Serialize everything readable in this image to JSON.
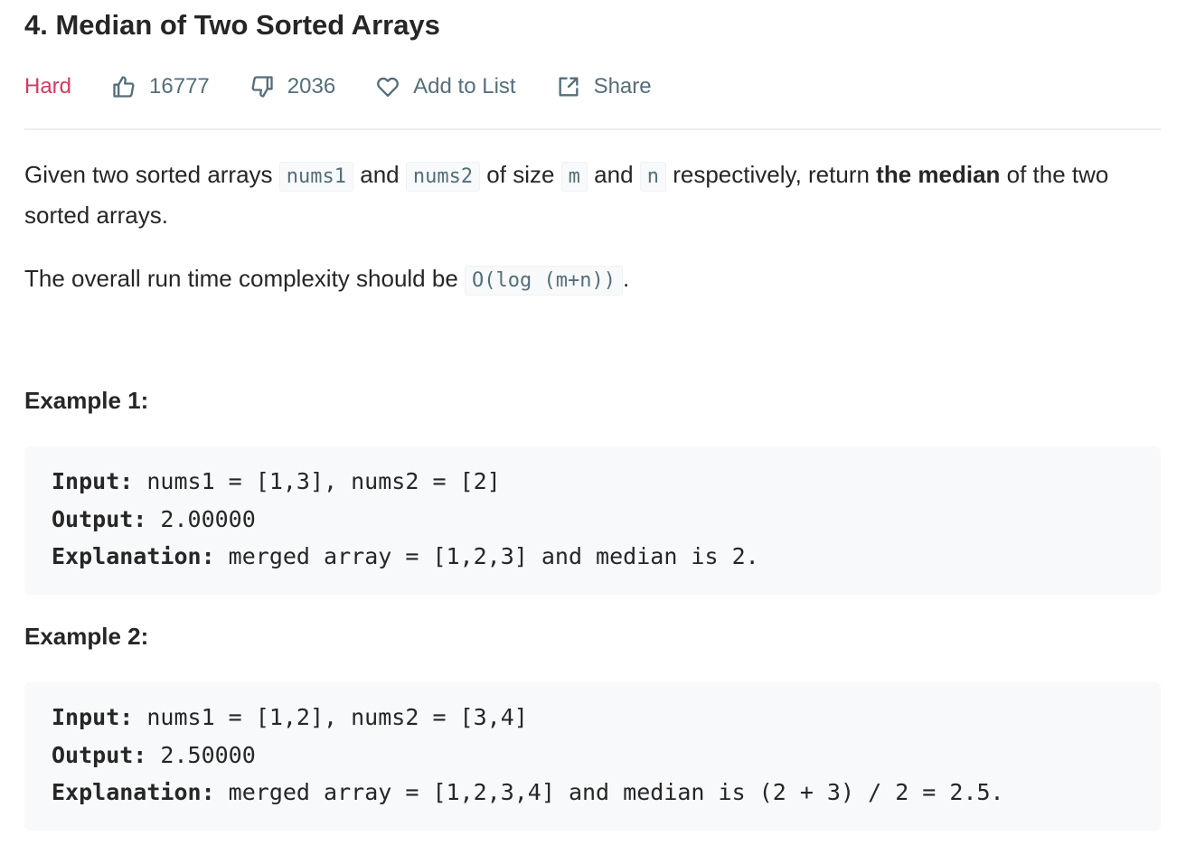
{
  "problem": {
    "title": "4. Median of Two Sorted Arrays",
    "difficulty": "Hard",
    "likes": "16777",
    "dislikes": "2036",
    "add_to_list": "Add to List",
    "share": "Share"
  },
  "description": {
    "p1_a": "Given two sorted arrays ",
    "p1_code1": "nums1",
    "p1_b": " and ",
    "p1_code2": "nums2",
    "p1_c": " of size ",
    "p1_code3": "m",
    "p1_d": " and ",
    "p1_code4": "n",
    "p1_e": " respectively, return ",
    "p1_bold": "the median",
    "p1_f": " of the two sorted arrays.",
    "p2_a": "The overall run time complexity should be ",
    "p2_code": "O(log (m+n))",
    "p2_b": "."
  },
  "examples": [
    {
      "heading": "Example 1:",
      "input_label": "Input:",
      "input_value": " nums1 = [1,3], nums2 = [2]",
      "output_label": "Output:",
      "output_value": " 2.00000",
      "explanation_label": "Explanation:",
      "explanation_value": " merged array = [1,2,3] and median is 2."
    },
    {
      "heading": "Example 2:",
      "input_label": "Input:",
      "input_value": " nums1 = [1,2], nums2 = [3,4]",
      "output_label": "Output:",
      "output_value": " 2.50000",
      "explanation_label": "Explanation:",
      "explanation_value": " merged array = [1,2,3,4] and median is (2 + 3) / 2 = 2.5."
    }
  ],
  "colors": {
    "difficulty_hard": "#d9385e",
    "meta_text": "#546e7a",
    "code_background": "#f7f9fa"
  },
  "icons": [
    "thumbs-up-icon",
    "thumbs-down-icon",
    "heart-icon",
    "share-icon"
  ]
}
